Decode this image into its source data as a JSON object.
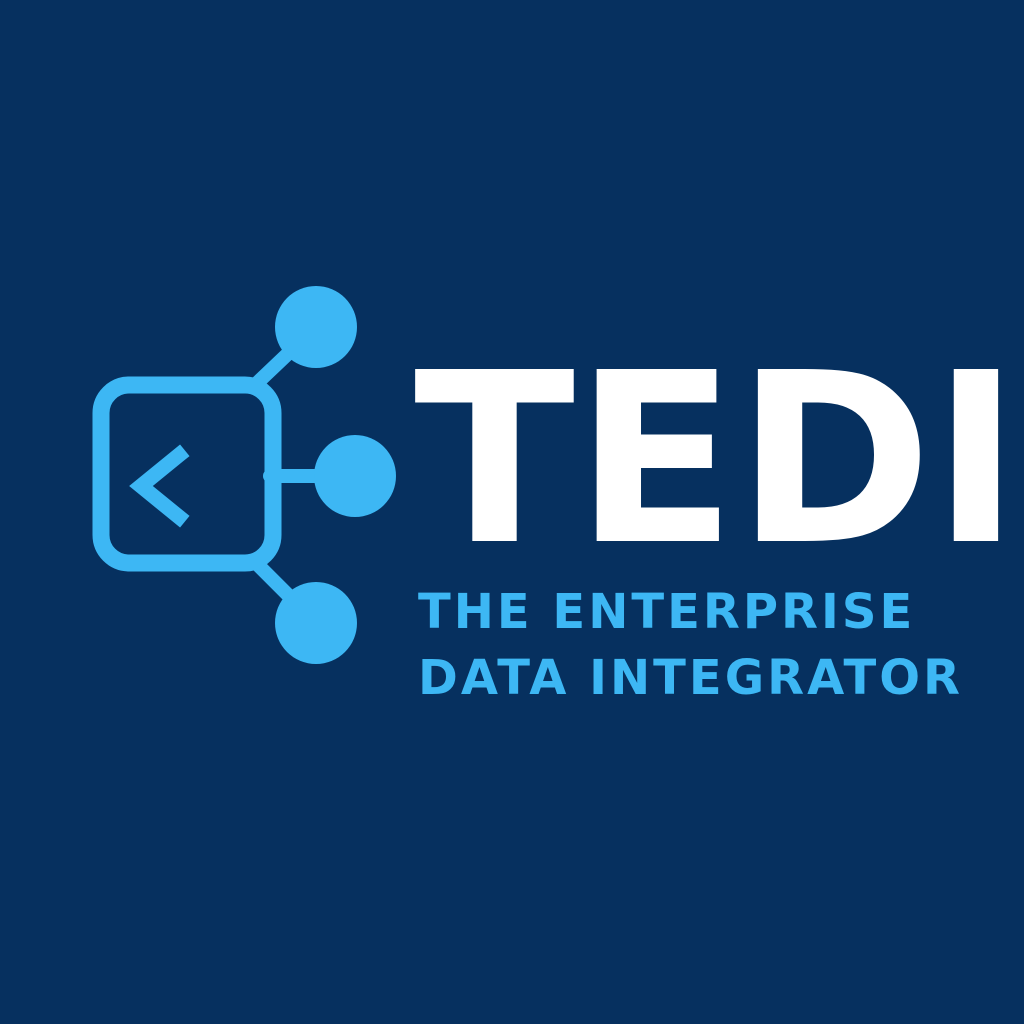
{
  "brand": {
    "name": "TEDI",
    "tagline_line1": "THE ENTERPRISE",
    "tagline_line2": "DATA INTEGRATOR"
  },
  "logo": {
    "icon": "data-node-connector-icon",
    "inner_icon": "chevron-left-icon"
  },
  "colors": {
    "background": "#06305f",
    "accent": "#3db7f4",
    "wordmark": "#ffffff"
  }
}
